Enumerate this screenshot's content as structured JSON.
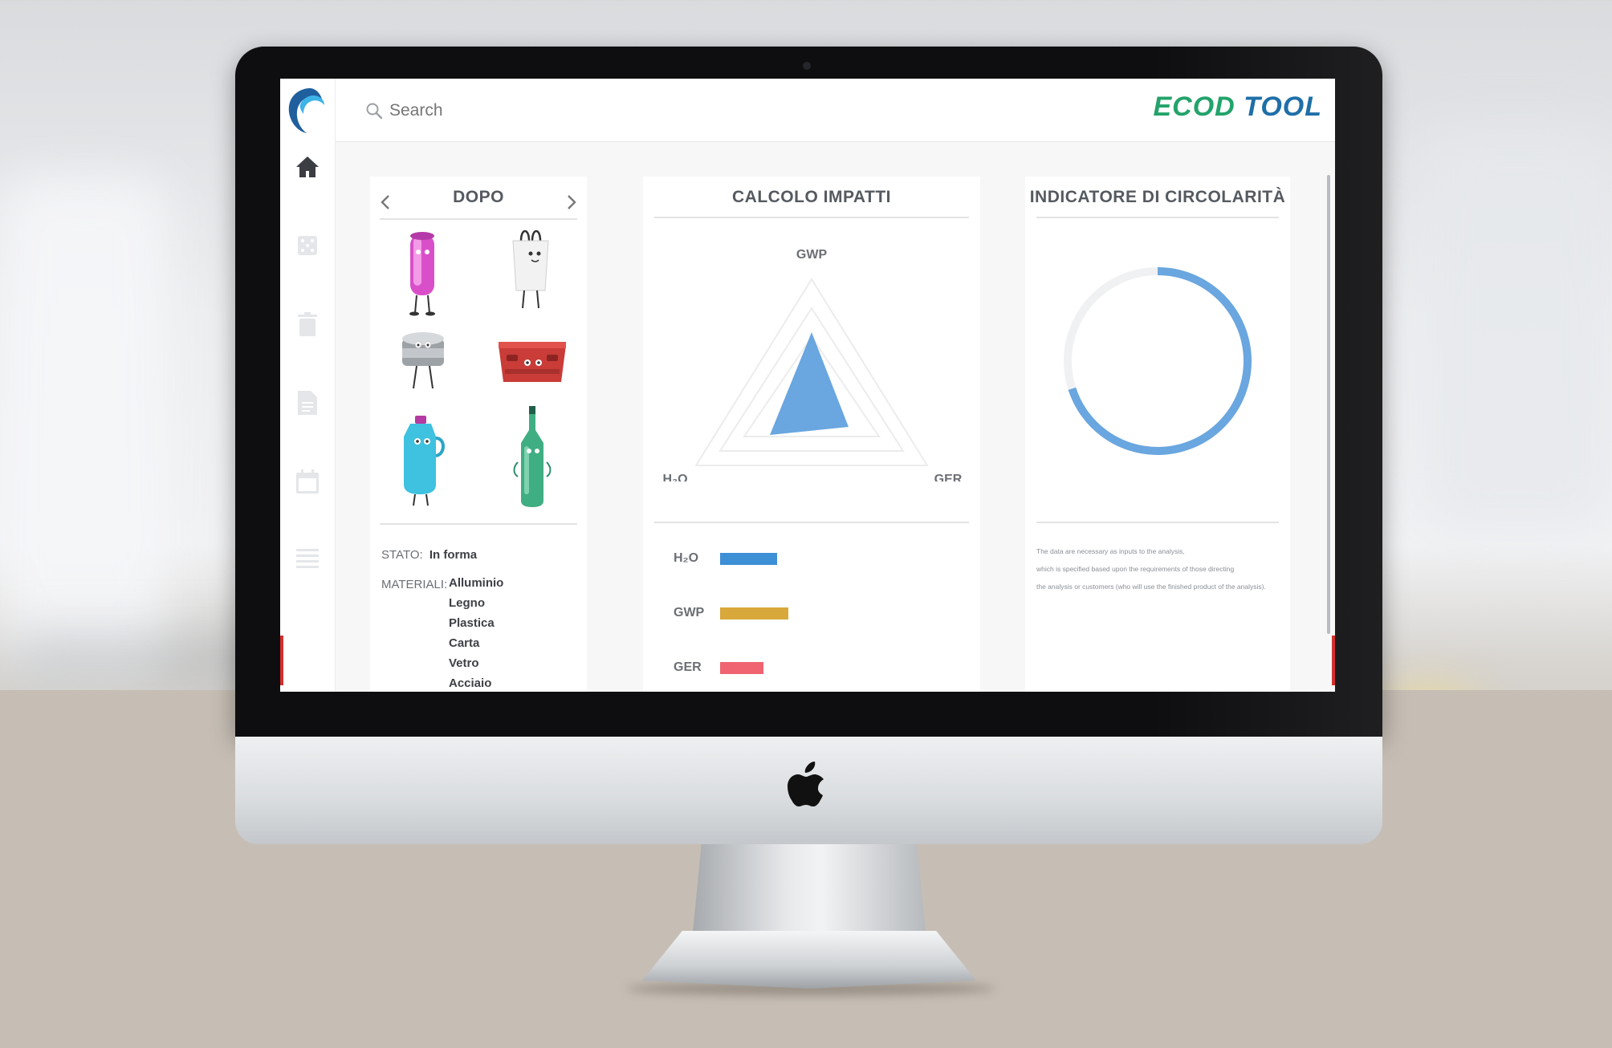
{
  "app": {
    "brand_part1": "ECOD",
    "brand_part2": "TOOL",
    "brand_colors": {
      "green": "#23a36b",
      "blue": "#1f6fa8"
    },
    "accent": "#6aa6df"
  },
  "search": {
    "placeholder": "Search",
    "icon": "search-icon"
  },
  "sidebar": {
    "items": [
      {
        "icon": "home-icon",
        "active": true
      },
      {
        "icon": "dice-icon",
        "active": false
      },
      {
        "icon": "trash-icon",
        "active": false
      },
      {
        "icon": "document-icon",
        "active": false
      },
      {
        "icon": "calendar-icon",
        "active": false
      },
      {
        "icon": "menu-icon",
        "active": false
      }
    ]
  },
  "products_panel": {
    "title": "DOPO",
    "prev_icon": "chevron-left-icon",
    "next_icon": "chevron-right-icon",
    "items": [
      "pink can character",
      "shopping bag character",
      "tin can character",
      "red crate character",
      "detergent bottle character",
      "green bottle character"
    ],
    "status_label": "STATO:",
    "status_value": "In forma",
    "materials_label": "MATERIALI:",
    "materials": [
      "Alluminio",
      "Legno",
      "Plastica",
      "Carta",
      "Vetro",
      "Acciaio"
    ]
  },
  "impact_panel": {
    "title": "CALCOLO IMPATTI",
    "radar_axes": [
      "GWP",
      "H₂O",
      "GER"
    ],
    "legend": [
      {
        "label": "H₂O",
        "color": "#3d8fd6",
        "value": 0.42
      },
      {
        "label": "GWP",
        "color": "#d9a83a",
        "value": 0.5
      },
      {
        "label": "GER",
        "color": "#ef6470",
        "value": 0.32
      }
    ]
  },
  "circularity_panel": {
    "title": "INDICATORE DI CIRCOLARITÀ",
    "ring_fraction": 0.7,
    "ring_color": "#6aa6df",
    "notes": [
      "The data are necessary as inputs to the analysis,",
      "which is specified based upon the requirements of those directing",
      "the analysis or customers (who will use the finished product of the analysis)."
    ]
  }
}
